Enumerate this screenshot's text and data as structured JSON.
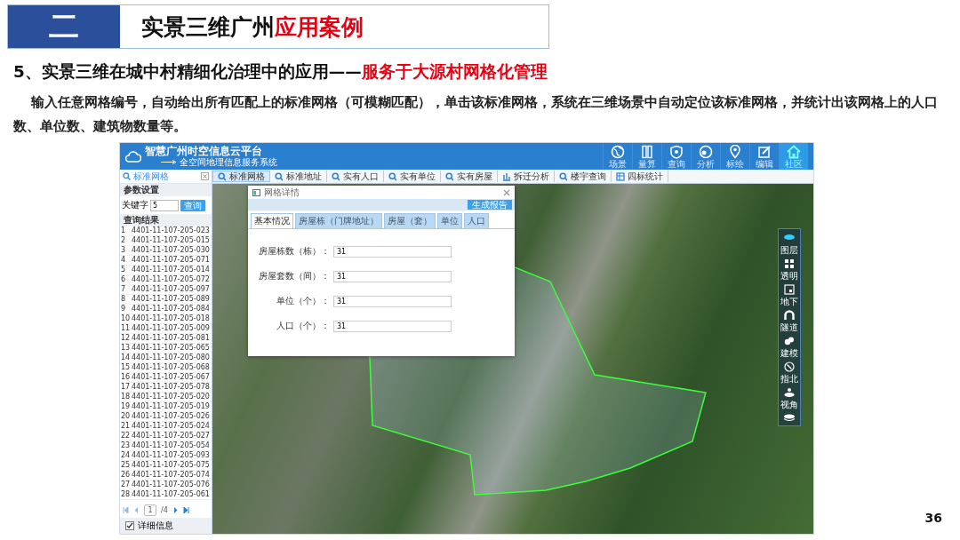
{
  "slide": {
    "section_number": "二",
    "title": {
      "text": "实景三维广州",
      "highlight": "应用案例"
    },
    "subtitle": {
      "text": "5、实景三维在城中村精细化治理中的应用——",
      "highlight": "服务于大源村网格化管理"
    },
    "description": "输入任意网格编号，自动给出所有匹配上的标准网格（可模糊匹配），单击该标准网格，系统在三维场景中自动定位该标准网格，并统计出该网格上的人口数、单位数、建筑物数量等。",
    "page_number": "36"
  },
  "app": {
    "header": {
      "title": "智慧广州时空信息云平台",
      "subtitle": "全空间地理信息服务系统"
    },
    "nav": [
      {
        "label": "场景",
        "selected": false
      },
      {
        "label": "量算",
        "selected": false
      },
      {
        "label": "查询",
        "selected": false
      },
      {
        "label": "分析",
        "selected": false
      },
      {
        "label": "标绘",
        "selected": false
      },
      {
        "label": "编辑",
        "selected": false
      },
      {
        "label": "社区",
        "selected": true
      }
    ],
    "toolbar": [
      {
        "label": "标准网格",
        "selected": true
      },
      {
        "label": "标准地址",
        "selected": false
      },
      {
        "label": "实有人口",
        "selected": false
      },
      {
        "label": "实有单位",
        "selected": false
      },
      {
        "label": "实有房屋",
        "selected": false
      },
      {
        "label": "拆迁分析",
        "selected": false
      },
      {
        "label": "楼宇查询",
        "selected": false
      },
      {
        "label": "四标统计",
        "selected": false
      }
    ],
    "left_panel": {
      "title": "标准网格",
      "params_header": "参数设置",
      "keyword_label": "关键字",
      "keyword_value": "5",
      "query_button": "查询",
      "results_header": "查询结果",
      "results": [
        {
          "index": "1",
          "code": "4401-11-107-205-023"
        },
        {
          "index": "2",
          "code": "4401-11-107-205-015"
        },
        {
          "index": "3",
          "code": "4401-11-107-205-030"
        },
        {
          "index": "4",
          "code": "4401-11-107-205-071"
        },
        {
          "index": "5",
          "code": "4401-11-107-205-014"
        },
        {
          "index": "6",
          "code": "4401-11-107-205-072"
        },
        {
          "index": "7",
          "code": "4401-11-107-205-097"
        },
        {
          "index": "8",
          "code": "4401-11-107-205-089"
        },
        {
          "index": "9",
          "code": "4401-11-107-205-084"
        },
        {
          "index": "10",
          "code": "4401-11-107-205-018"
        },
        {
          "index": "11",
          "code": "4401-11-107-205-009"
        },
        {
          "index": "12",
          "code": "4401-11-107-205-081"
        },
        {
          "index": "13",
          "code": "4401-11-107-205-065"
        },
        {
          "index": "14",
          "code": "4401-11-107-205-080"
        },
        {
          "index": "15",
          "code": "4401-11-107-205-068"
        },
        {
          "index": "16",
          "code": "4401-11-107-205-067"
        },
        {
          "index": "17",
          "code": "4401-11-107-205-078"
        },
        {
          "index": "18",
          "code": "4401-11-107-205-020"
        },
        {
          "index": "19",
          "code": "4401-11-107-205-019"
        },
        {
          "index": "20",
          "code": "4401-11-107-205-026"
        },
        {
          "index": "21",
          "code": "4401-11-107-205-024"
        },
        {
          "index": "22",
          "code": "4401-11-107-205-027"
        },
        {
          "index": "23",
          "code": "4401-11-107-205-054"
        },
        {
          "index": "24",
          "code": "4401-11-107-205-093"
        },
        {
          "index": "25",
          "code": "4401-11-107-205-075"
        },
        {
          "index": "26",
          "code": "4401-11-107-205-074"
        },
        {
          "index": "27",
          "code": "4401-11-107-205-076"
        },
        {
          "index": "28",
          "code": "4401-11-107-205-061"
        }
      ],
      "pager": {
        "page": "1",
        "total": "/4"
      },
      "detail_checkbox": {
        "label": "详细信息",
        "checked": true
      }
    },
    "dialog": {
      "title": "网格详情",
      "report_button": "生成报告",
      "tabs": [
        {
          "label": "基本情况",
          "selected": true
        },
        {
          "label": "房屋栋（门牌地址）",
          "selected": false
        },
        {
          "label": "房屋（套）",
          "selected": false
        },
        {
          "label": "单位",
          "selected": false
        },
        {
          "label": "人口",
          "selected": false
        }
      ],
      "fields": [
        {
          "label": "房屋栋数（栋）：",
          "value": "31"
        },
        {
          "label": "房屋套数（间）：",
          "value": "31"
        },
        {
          "label": "单位（个）：",
          "value": "31"
        },
        {
          "label": "人口（个）：",
          "value": "31"
        }
      ]
    },
    "side_tools": [
      {
        "label": "图层"
      },
      {
        "label": "透明"
      },
      {
        "label": "地下"
      },
      {
        "label": "隧道"
      },
      {
        "label": "建模"
      },
      {
        "label": "指北"
      },
      {
        "label": "视角"
      }
    ]
  }
}
